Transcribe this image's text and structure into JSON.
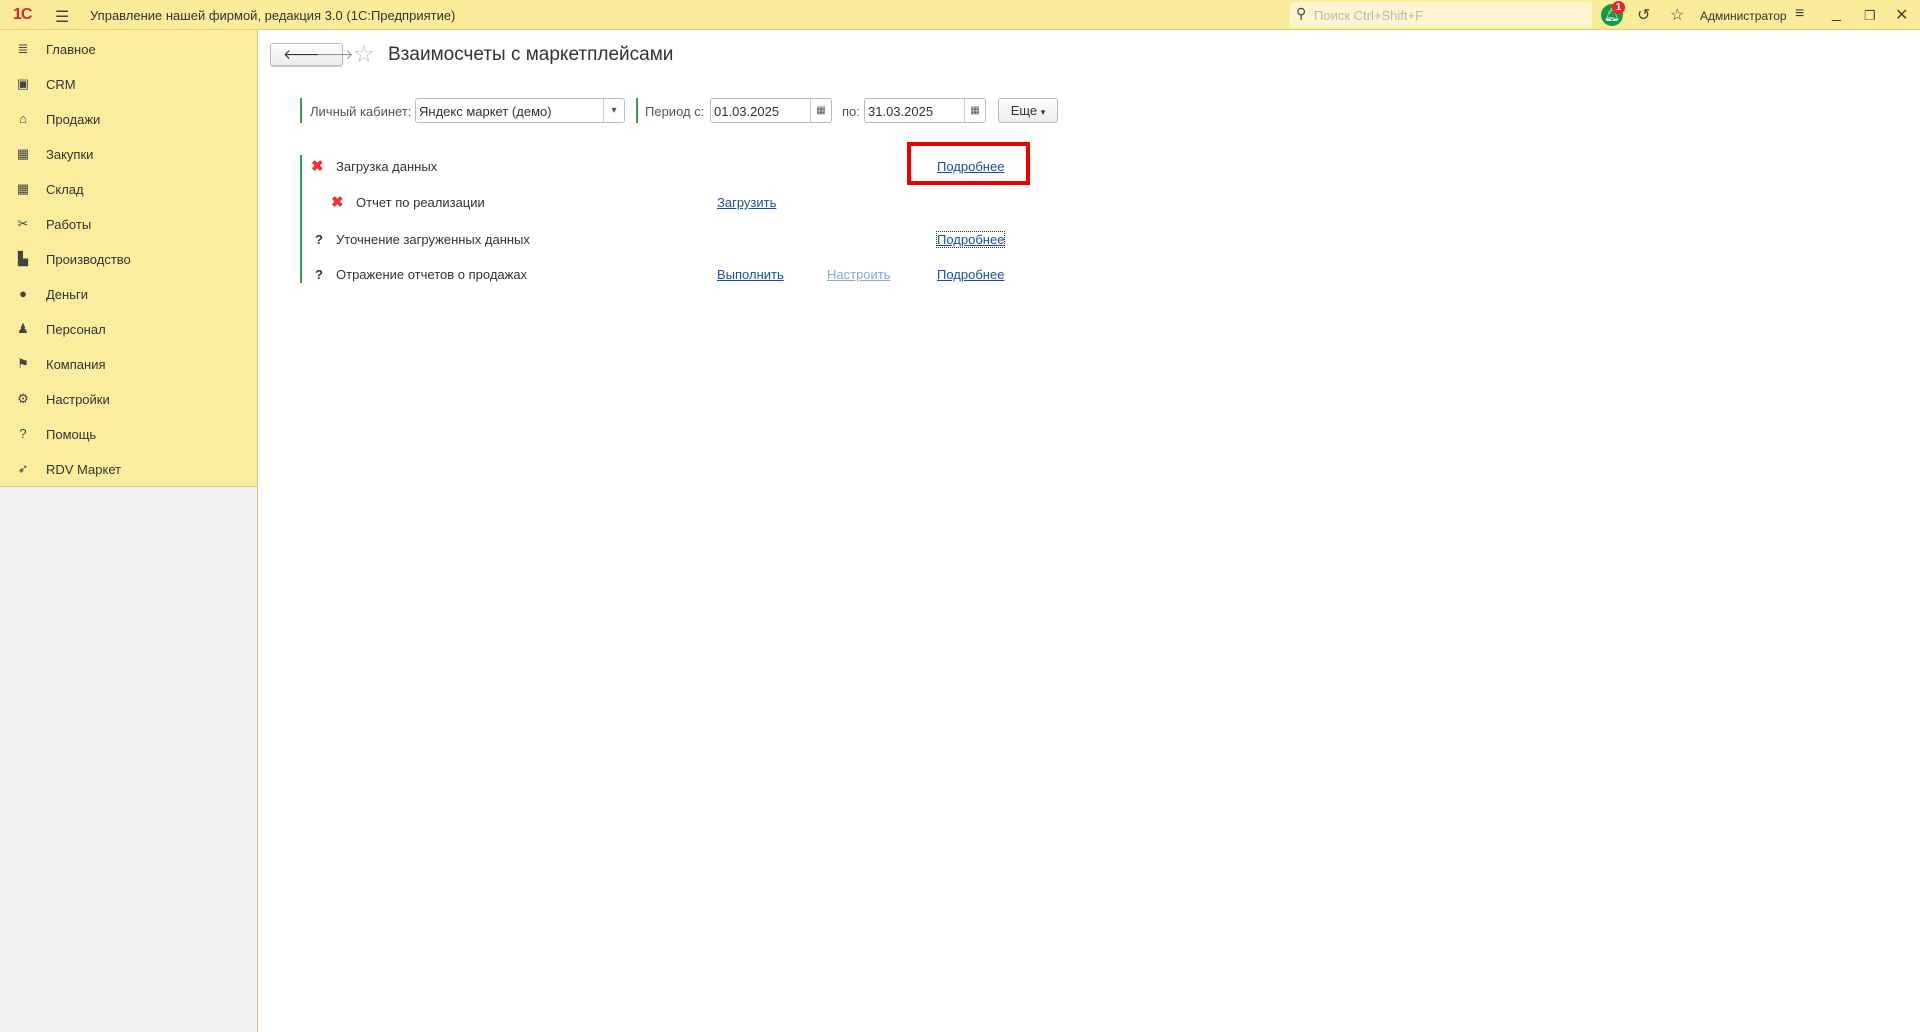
{
  "app": {
    "logo": "1С",
    "title": "Управление нашей фирмой, редакция 3.0  (1С:Предприятие)",
    "search_placeholder": "Поиск Ctrl+Shift+F",
    "notifications_count": "1",
    "user": "Администратор"
  },
  "sidebar": {
    "items": [
      {
        "label": "Главное",
        "icon": "menu-icon"
      },
      {
        "label": "CRM",
        "icon": "contact-card-icon"
      },
      {
        "label": "Продажи",
        "icon": "basket-icon"
      },
      {
        "label": "Закупки",
        "icon": "cart-icon"
      },
      {
        "label": "Склад",
        "icon": "warehouse-icon"
      },
      {
        "label": "Работы",
        "icon": "tools-icon"
      },
      {
        "label": "Производство",
        "icon": "factory-icon"
      },
      {
        "label": "Деньги",
        "icon": "money-icon"
      },
      {
        "label": "Персонал",
        "icon": "people-icon"
      },
      {
        "label": "Компания",
        "icon": "flag-icon"
      },
      {
        "label": "Настройки",
        "icon": "gear-icon"
      },
      {
        "label": "Помощь",
        "icon": "help-icon"
      },
      {
        "label": "RDV Маркет",
        "icon": "rocket-icon"
      }
    ]
  },
  "page": {
    "title": "Взаимосчеты с маркетплейсами"
  },
  "filters": {
    "account_label": "Личный кабинет:",
    "account_value": "Яндекс маркет (демо)",
    "period_from_label": "Период с:",
    "period_from": "01.03.2025",
    "period_to_label": "по:",
    "period_to": "31.03.2025",
    "more_label": "Еще"
  },
  "steps": [
    {
      "status": "error",
      "label": "Загрузка данных",
      "details": "Подробнее"
    },
    {
      "status": "error",
      "label": "Отчет по реализации",
      "action": "Загрузить"
    },
    {
      "status": "unknown",
      "label": "Уточнение загруженных данных",
      "details": "Подробнее"
    },
    {
      "status": "unknown",
      "label": "Отражение отчетов о продажах",
      "action": "Выполнить",
      "configure": "Настроить",
      "details": "Подробнее"
    }
  ],
  "colors": {
    "accent": "#2f9e54",
    "highlight": "#e00000",
    "link": "#1c4fa0"
  }
}
